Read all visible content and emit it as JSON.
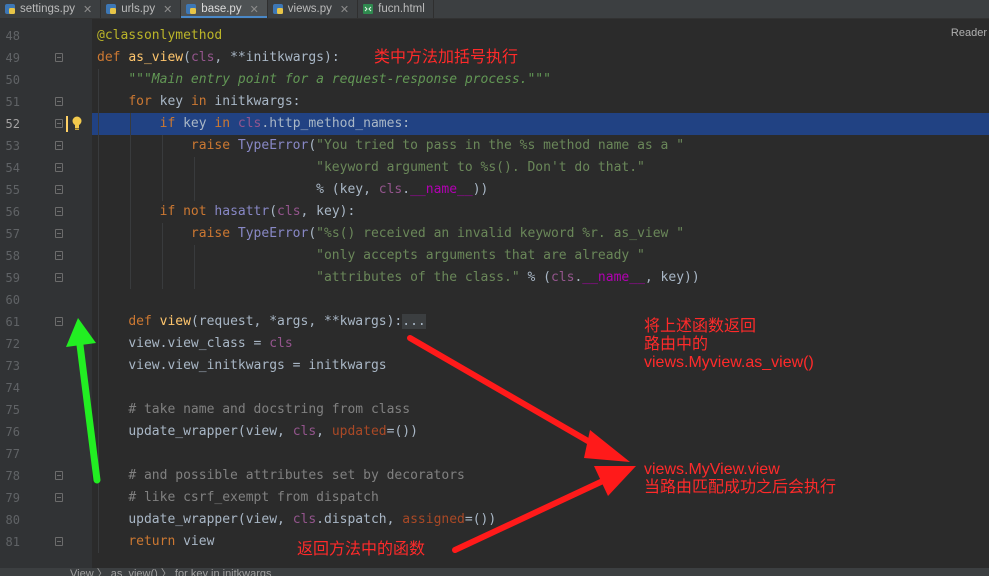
{
  "tabs": [
    {
      "label": "settings.py"
    },
    {
      "label": "urls.py"
    },
    {
      "label": "base.py"
    },
    {
      "label": "views.py"
    },
    {
      "label": "fucn.html"
    }
  ],
  "reader_label": "Reader",
  "lines": [
    {
      "n": "48"
    },
    {
      "n": "49"
    },
    {
      "n": "50"
    },
    {
      "n": "51"
    },
    {
      "n": "52"
    },
    {
      "n": "53"
    },
    {
      "n": "54"
    },
    {
      "n": "55"
    },
    {
      "n": "56"
    },
    {
      "n": "57"
    },
    {
      "n": "58"
    },
    {
      "n": "59"
    },
    {
      "n": "60"
    },
    {
      "n": "61"
    },
    {
      "n": "72"
    },
    {
      "n": "73"
    },
    {
      "n": "74"
    },
    {
      "n": "75"
    },
    {
      "n": "76"
    },
    {
      "n": "77"
    },
    {
      "n": "78"
    },
    {
      "n": "79"
    },
    {
      "n": "80"
    },
    {
      "n": "81"
    }
  ],
  "code": {
    "l48_dec": "@classonlymethod",
    "l49_def": "def",
    "l49_fn": "as_view",
    "l49_rest_a": "(",
    "l49_cls": "cls",
    "l49_rest_b": ", **initkwargs):",
    "l50_doc": "\"\"\"Main entry point for a request-response process.\"\"\"",
    "l51_for": "for",
    "l51_mid": " key ",
    "l51_in": "in",
    "l51_end": " initkwargs:",
    "l52_if": "if",
    "l52_mid": " key ",
    "l52_in": "in",
    "l52_cls": " cls",
    "l52_end": ".http_method_names:",
    "l53_raise": "raise",
    "l53_type": " TypeError",
    "l53_p": "(",
    "l53_str": "\"You tried to pass in the %s method name as a \"",
    "l54_str": "\"keyword argument to %s(). Don't do that.\"",
    "l55_a": "% (key, ",
    "l55_cls": "cls",
    "l55_b": ".",
    "l55_magic": "__name__",
    "l55_c": "))",
    "l56_if": "if",
    "l56_not": " not",
    "l56_has": " hasattr",
    "l56_a": "(",
    "l56_cls": "cls",
    "l56_b": ", key):",
    "l57_raise": "raise",
    "l57_type": " TypeError",
    "l57_p": "(",
    "l57_str": "\"%s() received an invalid keyword %r. as_view \"",
    "l58_str": "\"only accepts arguments that are already \"",
    "l59_str": "\"attributes of the class.\"",
    "l59_a": " % (",
    "l59_cls": "cls",
    "l59_b": ".",
    "l59_magic": "__name__",
    "l59_c": ", key))",
    "l61_def": "def",
    "l61_fn": " view",
    "l61_a": "(request, *args, **kwargs):",
    "l61_fold": "...",
    "l72_a": "view.view_class = ",
    "l72_cls": "cls",
    "l73_a": "view.view_initkwargs = initkwargs",
    "l75_cm": "# take name and docstring from class",
    "l76_a": "update_wrapper(view, ",
    "l76_cls": "cls",
    "l76_b": ", ",
    "l76_prm": "updated",
    "l76_c": "=())",
    "l78_cm": "# and possible attributes set by decorators",
    "l79_cm": "# like csrf_exempt from dispatch",
    "l80_a": "update_wrapper(view, ",
    "l80_cls": "cls",
    "l80_b": ".dispatch, ",
    "l80_prm": "assigned",
    "l80_c": "=())",
    "l81_ret": "return",
    "l81_a": " view"
  },
  "annotations": {
    "a1": "类中方法加括号执行",
    "a2": "将上述函数返回\n路由中的\nviews.Myview.as_view()",
    "a3": "views.MyView.view\n当路由匹配成功之后会执行",
    "a4": "返回方法中的函数"
  },
  "breadcrumb": "View  〉 as_view()  〉 for key in initkwargs",
  "colors": {
    "annotation": "#ff2a2a",
    "green_arrow": "#22ee22",
    "selection": "#214283"
  },
  "icons": [
    "python-file-icon",
    "html-file-icon",
    "close-icon",
    "lightbulb-icon",
    "fold-icon"
  ]
}
